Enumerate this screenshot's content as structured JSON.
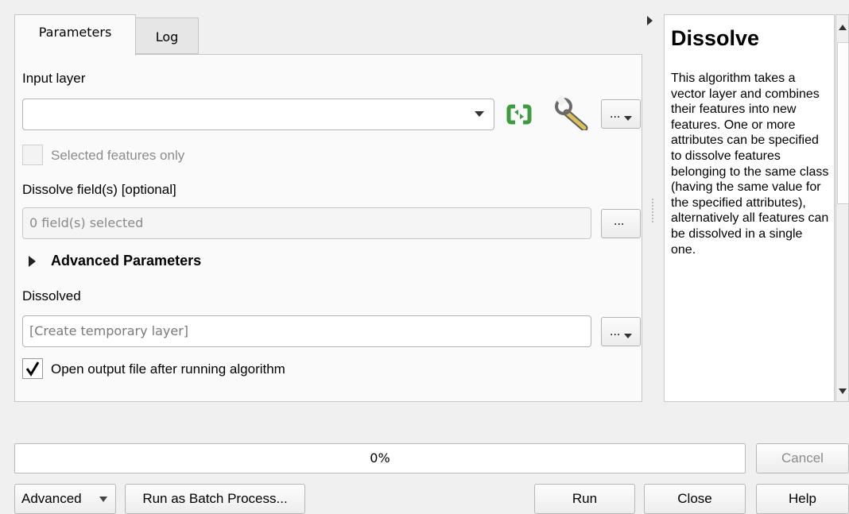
{
  "tabs": {
    "parameters": "Parameters",
    "log": "Log"
  },
  "params": {
    "input_layer_label": "Input layer",
    "input_layer_value": "",
    "selected_only_label": "Selected features only",
    "dissolve_fields_label": "Dissolve field(s) [optional]",
    "dissolve_fields_value": "0 field(s) selected",
    "advanced_label": "Advanced Parameters",
    "dissolved_label": "Dissolved",
    "dissolved_placeholder": "[Create temporary layer]",
    "open_output_label": "Open output file after running algorithm",
    "open_output_checked": true,
    "more_button": "..."
  },
  "help": {
    "title": "Dissolve",
    "body": "This algorithm takes a vector layer and combines their features into new features. One or more attributes can be specified to dissolve features belonging to the same class (having the same value for the specified attributes), alternatively all features can be dissolved in a single one."
  },
  "progress": {
    "value": 0,
    "text": "0%"
  },
  "buttons": {
    "cancel": "Cancel",
    "advanced": "Advanced",
    "batch": "Run as Batch Process...",
    "run": "Run",
    "close": "Close",
    "help": "Help"
  },
  "icons": {
    "refresh": "refresh-icon",
    "wrench": "wrench-icon",
    "dropdown": "chevron-down-icon",
    "advanced_toggle": "triangle-right-icon",
    "checkmark": "checkmark-icon"
  },
  "colors": {
    "refresh_green": "#3f9b3f",
    "panel_bg": "#fafafa",
    "window_bg": "#f0f0f0"
  }
}
